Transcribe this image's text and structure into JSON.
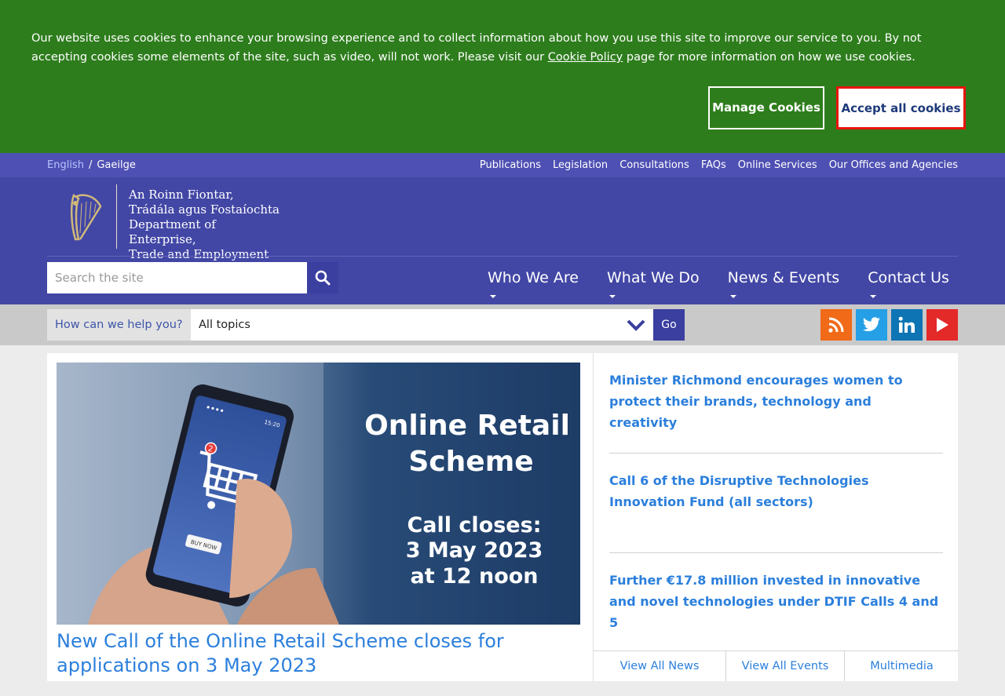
{
  "cookie": {
    "text_before": "Our website uses cookies to enhance your browsing experience and to collect information about how you use this site to improve our service to you. By not accepting cookies some elements of the site, such as video, will not work. Please visit our ",
    "policy_link": "Cookie Policy",
    "text_after": " page for more information on how we use cookies.",
    "manage_label": "Manage Cookies",
    "accept_label": "Accept all cookies"
  },
  "utility": {
    "lang_en": "English",
    "lang_sep": "/",
    "lang_ga": "Gaeilge",
    "links": [
      "Publications",
      "Legislation",
      "Consultations",
      "FAQs",
      "Online Services",
      "Our Offices and Agencies"
    ]
  },
  "logo": {
    "line1": "An Roinn Fiontar,",
    "line2": "Trádála agus Fostaíochta",
    "line3": "Department of Enterprise,",
    "line4": "Trade and Employment"
  },
  "search": {
    "placeholder": "Search the site"
  },
  "nav": [
    "Who We Are",
    "What We Do",
    "News & Events",
    "Contact Us"
  ],
  "help": {
    "label": "How can we help you?",
    "selected_topic": "All topics",
    "go_label": "Go"
  },
  "social": [
    "rss-icon",
    "twitter-icon",
    "linkedin-icon",
    "youtube-icon"
  ],
  "feature": {
    "image_heading_line1": "Online Retail",
    "image_heading_line2": "Scheme",
    "image_sub_line1": "Call closes:",
    "image_sub_line2": "3 May 2023",
    "image_sub_line3": "at 12 noon",
    "phone_time": "15:20",
    "cart_badge": "2",
    "buy_now": "BUY NOW",
    "title": "New Call of the Online Retail Scheme closes for applications on 3 May 2023"
  },
  "news": {
    "items": [
      "Minister Richmond encourages women to protect their brands, technology and creativity",
      "Call 6 of the Disruptive Technologies Innovation Fund (all sectors)",
      "Further €17.8 million invested in innovative and novel technologies under DTIF Calls 4 and 5"
    ],
    "tabs": [
      "View All News",
      "View All Events",
      "Multimedia"
    ]
  },
  "colors": {
    "cookie_bg": "#2e7d1d",
    "header_bg": "#4247a5",
    "utilbar_bg": "#4e50b3",
    "link_blue": "#2b7fdc",
    "accept_border": "#e8140c"
  }
}
